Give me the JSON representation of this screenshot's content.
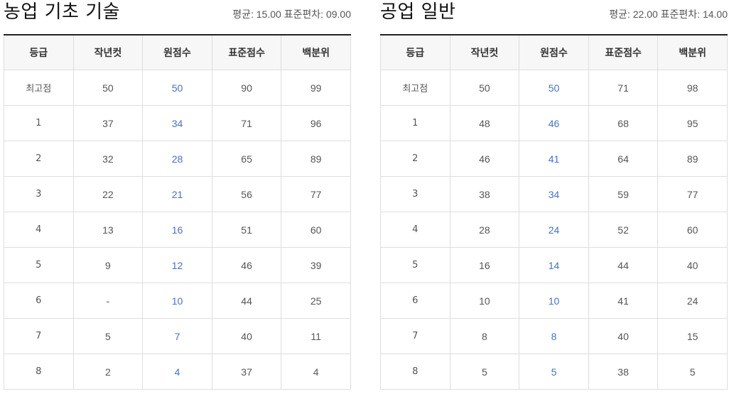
{
  "columns": [
    "등급",
    "작년컷",
    "원점수",
    "표준점수",
    "백분위"
  ],
  "subjects": [
    {
      "title": "농업 기초 기술",
      "stats": "평균: 15.00 표준편차: 09.00",
      "rows": [
        [
          "최고점",
          "50",
          "50",
          "90",
          "99"
        ],
        [
          "1",
          "37",
          "34",
          "71",
          "96"
        ],
        [
          "2",
          "32",
          "28",
          "65",
          "89"
        ],
        [
          "3",
          "22",
          "21",
          "56",
          "77"
        ],
        [
          "4",
          "13",
          "16",
          "51",
          "60"
        ],
        [
          "5",
          "9",
          "12",
          "46",
          "39"
        ],
        [
          "6",
          "-",
          "10",
          "44",
          "25"
        ],
        [
          "7",
          "5",
          "7",
          "40",
          "11"
        ],
        [
          "8",
          "2",
          "4",
          "37",
          "4"
        ]
      ]
    },
    {
      "title": "공업 일반",
      "stats": "평균: 22.00 표준편차: 14.00",
      "rows": [
        [
          "최고점",
          "50",
          "50",
          "71",
          "98"
        ],
        [
          "1",
          "48",
          "46",
          "68",
          "95"
        ],
        [
          "2",
          "46",
          "41",
          "64",
          "89"
        ],
        [
          "3",
          "38",
          "34",
          "59",
          "77"
        ],
        [
          "4",
          "28",
          "24",
          "52",
          "60"
        ],
        [
          "5",
          "16",
          "14",
          "44",
          "40"
        ],
        [
          "6",
          "10",
          "10",
          "41",
          "24"
        ],
        [
          "7",
          "8",
          "8",
          "40",
          "15"
        ],
        [
          "8",
          "5",
          "5",
          "38",
          "5"
        ]
      ]
    }
  ],
  "colors": {
    "raw_score": "#4a6fc2",
    "header_bg": "#f7f7f7",
    "border": "#dedede"
  }
}
